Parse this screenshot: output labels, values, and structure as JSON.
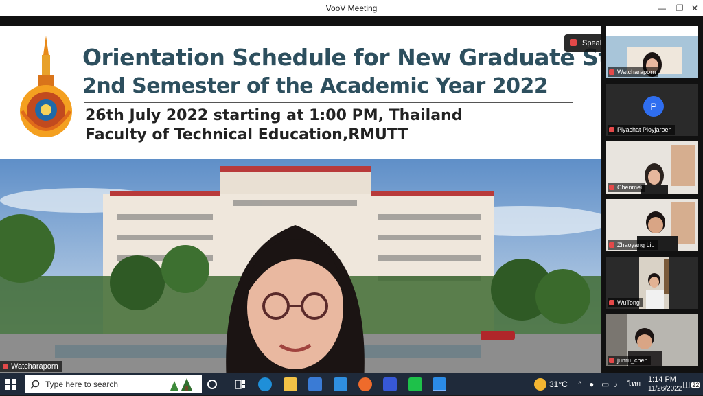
{
  "window": {
    "title": "VooV Meeting"
  },
  "slide": {
    "title_line_1": "Orientation Schedule for New Graduate Students",
    "title_line_2": "2nd Semester of the Academic Year 2022",
    "date_line": "26th July 2022 starting at 1:00 PM, Thailand",
    "faculty_line": "Faculty of Technical Education,RMUTT"
  },
  "speaking_badge": {
    "text": "Speaking: Arnon’ s RMUTT;"
  },
  "self_view": {
    "name": "Watcharaporn"
  },
  "participants": [
    {
      "name": "Watcharaporn",
      "avatar": ""
    },
    {
      "name": "Piyachat Ployjaroen",
      "avatar": "P"
    },
    {
      "name": "Chenmei",
      "avatar": ""
    },
    {
      "name": "Zhaoyang Liu",
      "avatar": ""
    },
    {
      "name": "WuTong",
      "avatar": ""
    },
    {
      "name": "junru_chen",
      "avatar": ""
    }
  ],
  "taskbar": {
    "search_placeholder": "Type here to search",
    "weather": "31°C",
    "language": "ไทย",
    "time": "1:14 PM",
    "date": "11/26/2022",
    "notification_count": "22"
  },
  "colors": {
    "accent": "#2f6ef0",
    "title_text": "#2d4f5e",
    "muted_mic": "#e34949",
    "taskbar": "#1f2a3a"
  }
}
